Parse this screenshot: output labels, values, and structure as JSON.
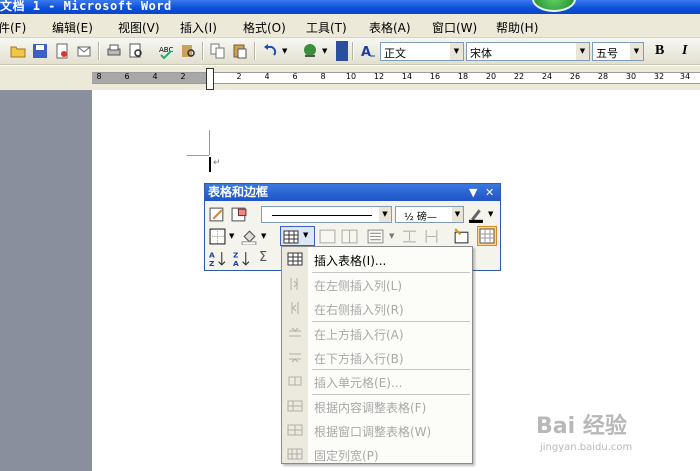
{
  "window": {
    "title": "文档 1 - Microsoft Word"
  },
  "menubar": {
    "items": [
      "文件(F)",
      "编辑(E)",
      "视图(V)",
      "插入(I)",
      "格式(O)",
      "工具(T)",
      "表格(A)",
      "窗口(W)",
      "帮助(H)"
    ]
  },
  "toolbar": {
    "style_value": "正文",
    "font_value": "宋体",
    "size_value": "五号",
    "bold_label": "B",
    "italic_label": "I"
  },
  "ruler": {
    "numbers": [
      "8",
      "6",
      "4",
      "2",
      "2",
      "4",
      "6",
      "8",
      "10",
      "12",
      "14",
      "16",
      "18",
      "20",
      "22",
      "24",
      "26",
      "28",
      "30",
      "32",
      "34"
    ]
  },
  "tables_toolbar": {
    "title": "表格和边框",
    "line_weight": "½ 磅—"
  },
  "dropdown": {
    "items": [
      {
        "label": "插入表格(I)...",
        "enabled": true,
        "icon": "insert-table-icon"
      },
      {
        "label": "在左侧插入列(L)",
        "enabled": false,
        "icon": "insert-column-left-icon"
      },
      {
        "label": "在右侧插入列(R)",
        "enabled": false,
        "icon": "insert-column-right-icon"
      },
      {
        "label": "在上方插入行(A)",
        "enabled": false,
        "icon": "insert-row-above-icon"
      },
      {
        "label": "在下方插入行(B)",
        "enabled": false,
        "icon": "insert-row-below-icon"
      },
      {
        "label": "插入单元格(E)...",
        "enabled": false,
        "icon": "insert-cell-icon"
      },
      {
        "label": "根据内容调整表格(F)",
        "enabled": false,
        "icon": "autofit-contents-icon"
      },
      {
        "label": "根据窗口调整表格(W)",
        "enabled": false,
        "icon": "autofit-window-icon"
      },
      {
        "label": "固定列宽(P)",
        "enabled": false,
        "icon": "fixed-column-width-icon"
      }
    ]
  },
  "watermark": {
    "brand": "Bai 经验",
    "url": "jingyan.baidu.com"
  }
}
